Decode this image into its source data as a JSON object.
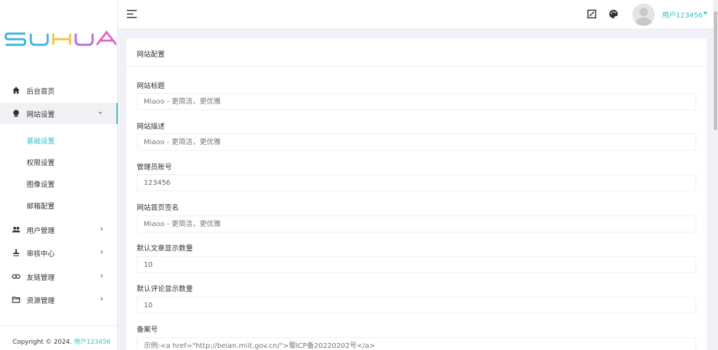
{
  "logo": {
    "text": "SUHUA",
    "colors": [
      "#3ab3e6",
      "#3ab3e6",
      "#f0c33c",
      "#b06ee0",
      "#e066c8"
    ]
  },
  "nav": [
    {
      "label": "后台首页",
      "icon": "home-icon"
    },
    {
      "label": "网站设置",
      "icon": "globe-icon",
      "expanded": true
    },
    {
      "label": "用户管理",
      "icon": "users-icon"
    },
    {
      "label": "审核中心",
      "icon": "stamp-icon"
    },
    {
      "label": "友链管理",
      "icon": "link-icon"
    },
    {
      "label": "资源管理",
      "icon": "folder-icon"
    }
  ],
  "sub_nav": [
    {
      "label": "基础设置",
      "active": true
    },
    {
      "label": "权限设置"
    },
    {
      "label": "图像设置"
    },
    {
      "label": "邮箱配置"
    }
  ],
  "copyright": {
    "prefix": "Copyright © 2024.",
    "user": "用户123456"
  },
  "header": {
    "user_name": "用户123456"
  },
  "card": {
    "title": "网站配置"
  },
  "fields": [
    {
      "label": "网站标题",
      "placeholder": "Miaoo - 更简洁，更优雅"
    },
    {
      "label": "网站描述",
      "placeholder": "Miaoo - 更简洁，更优雅"
    },
    {
      "label": "管理员账号",
      "value": "123456"
    },
    {
      "label": "网站首页签名",
      "placeholder": "Miaoo - 更简洁，更优雅"
    },
    {
      "label": "默认文章显示数量",
      "value": "10"
    },
    {
      "label": "默认评论显示数量",
      "value": "10"
    },
    {
      "label": "备案号",
      "placeholder": "示例:<a href=\"http://beian.miit.gov.cn/\">蜀ICP备20220202号</a>"
    }
  ],
  "colors": {
    "accent": "#36c0c4",
    "background": "#f1f2f7"
  }
}
